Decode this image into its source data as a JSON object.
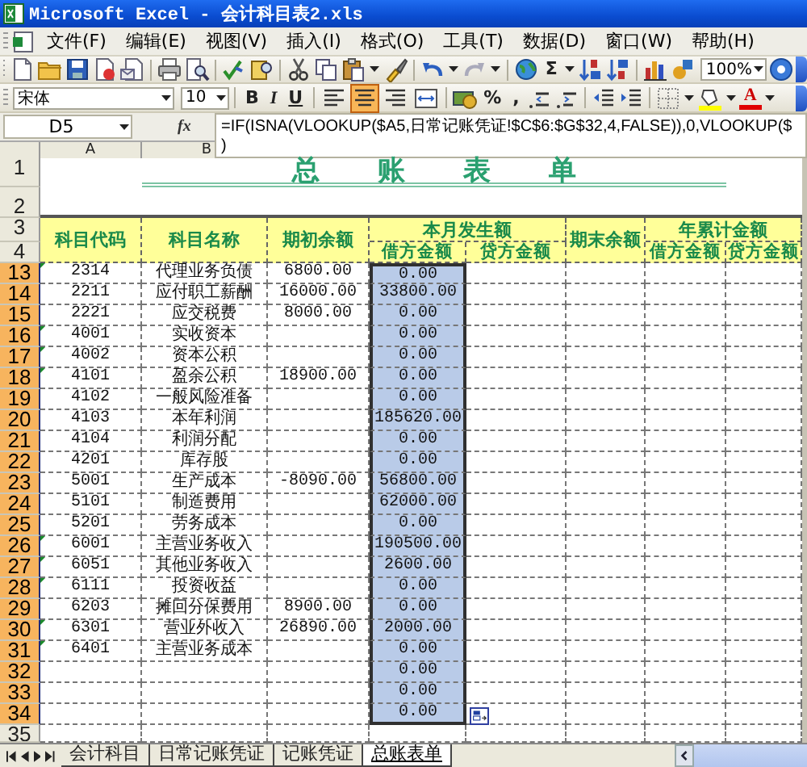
{
  "window": {
    "title": "Microsoft Excel - 会计科目表2.xls"
  },
  "menu": [
    "文件(F)",
    "编辑(E)",
    "视图(V)",
    "插入(I)",
    "格式(O)",
    "工具(T)",
    "数据(D)",
    "窗口(W)",
    "帮助(H)"
  ],
  "standard_toolbar": {
    "sum_label": "Σ",
    "zoom": "100%"
  },
  "format_toolbar": {
    "font": "宋体",
    "size": "10",
    "style_buttons": [
      "B",
      "I",
      "U"
    ],
    "align_buttons": [
      {
        "kind": "left",
        "selected": false
      },
      {
        "kind": "center",
        "selected": true
      },
      {
        "kind": "right",
        "selected": false
      },
      {
        "kind": "merge",
        "selected": false
      }
    ],
    "percent_label": "%",
    "comma_label": ",",
    "font_color_label": "A"
  },
  "formula_bar": {
    "name_box": "D5",
    "function_label": "fx",
    "formula_lines": [
      "=IF(ISNA(VLOOKUP($A5,日常记账凭证!$C$6:$G$32,4,FALSE)),0,VLOOKUP($",
      ")"
    ]
  },
  "column_headers": [
    "A",
    "B"
  ],
  "sheet": {
    "title": "总账表单",
    "headers": {
      "code": "科目代码",
      "name": "科目名称",
      "opening": "期初余额",
      "month": "本月发生额",
      "month_debit": "借方金额",
      "month_credit": "贷方金额",
      "closing": "期末余额",
      "year": "年累计金额",
      "year_debit": "借方金额",
      "year_credit": "贷方金额"
    },
    "header_row_numbers": [
      "1",
      "2",
      "3",
      "4"
    ],
    "rows": [
      {
        "row": "13",
        "code": "2314",
        "name": "代理业务负债",
        "opening": "6800.00",
        "debit": "0.00",
        "selected": true,
        "flagged": true
      },
      {
        "row": "14",
        "code": "2211",
        "name": "应付职工薪酬",
        "opening": "16000.00",
        "debit": "33800.00",
        "selected": true,
        "flagged": false
      },
      {
        "row": "15",
        "code": "2221",
        "name": "应交税费",
        "opening": "8000.00",
        "debit": "0.00",
        "selected": true,
        "flagged": false
      },
      {
        "row": "16",
        "code": "4001",
        "name": "实收资本",
        "debit": "0.00",
        "selected": true,
        "flagged": true
      },
      {
        "row": "17",
        "code": "4002",
        "name": "资本公积",
        "debit": "0.00",
        "selected": true,
        "flagged": true
      },
      {
        "row": "18",
        "code": "4101",
        "name": "盈余公积",
        "opening": "18900.00",
        "debit": "0.00",
        "selected": true,
        "flagged": true
      },
      {
        "row": "19",
        "code": "4102",
        "name": "一般风险准备",
        "debit": "0.00",
        "selected": true,
        "flagged": false
      },
      {
        "row": "20",
        "code": "4103",
        "name": "本年利润",
        "debit": "185620.00",
        "selected": true,
        "flagged": false
      },
      {
        "row": "21",
        "code": "4104",
        "name": "利润分配",
        "debit": "0.00",
        "selected": true,
        "flagged": false
      },
      {
        "row": "22",
        "code": "4201",
        "name": "库存股",
        "debit": "0.00",
        "selected": true,
        "flagged": false
      },
      {
        "row": "23",
        "code": "5001",
        "name": "生产成本",
        "opening": "-8090.00",
        "debit": "56800.00",
        "selected": true,
        "flagged": false
      },
      {
        "row": "24",
        "code": "5101",
        "name": "制造费用",
        "debit": "62000.00",
        "selected": true,
        "flagged": false
      },
      {
        "row": "25",
        "code": "5201",
        "name": "劳务成本",
        "debit": "0.00",
        "selected": true,
        "flagged": false
      },
      {
        "row": "26",
        "code": "6001",
        "name": "主营业务收入",
        "debit": "190500.00",
        "selected": true,
        "flagged": true
      },
      {
        "row": "27",
        "code": "6051",
        "name": "其他业务收入",
        "debit": "2600.00",
        "selected": true,
        "flagged": true
      },
      {
        "row": "28",
        "code": "6111",
        "name": "投资收益",
        "debit": "0.00",
        "selected": true,
        "flagged": true
      },
      {
        "row": "29",
        "code": "6203",
        "name": "摊回分保费用",
        "opening": "8900.00",
        "debit": "0.00",
        "selected": true,
        "flagged": false
      },
      {
        "row": "30",
        "code": "6301",
        "name": "营业外收入",
        "opening": "26890.00",
        "debit": "2000.00",
        "selected": true,
        "flagged": true
      },
      {
        "row": "31",
        "code": "6401",
        "name": "主营业务成本",
        "debit": "0.00",
        "selected": true,
        "flagged": true
      },
      {
        "row": "32",
        "debit": "0.00",
        "selected": true,
        "flagged": false
      },
      {
        "row": "33",
        "debit": "0.00",
        "selected": true,
        "flagged": false
      },
      {
        "row": "34",
        "debit": "0.00",
        "selected": true,
        "flagged": false
      },
      {
        "row": "35",
        "selected": false,
        "flagged": false
      }
    ]
  },
  "sheet_tabs": [
    {
      "label": "会计科目",
      "selected": false
    },
    {
      "label": "日常记账凭证",
      "selected": false
    },
    {
      "label": "记账凭证",
      "selected": false
    },
    {
      "label": "总账表单",
      "selected": true
    }
  ]
}
